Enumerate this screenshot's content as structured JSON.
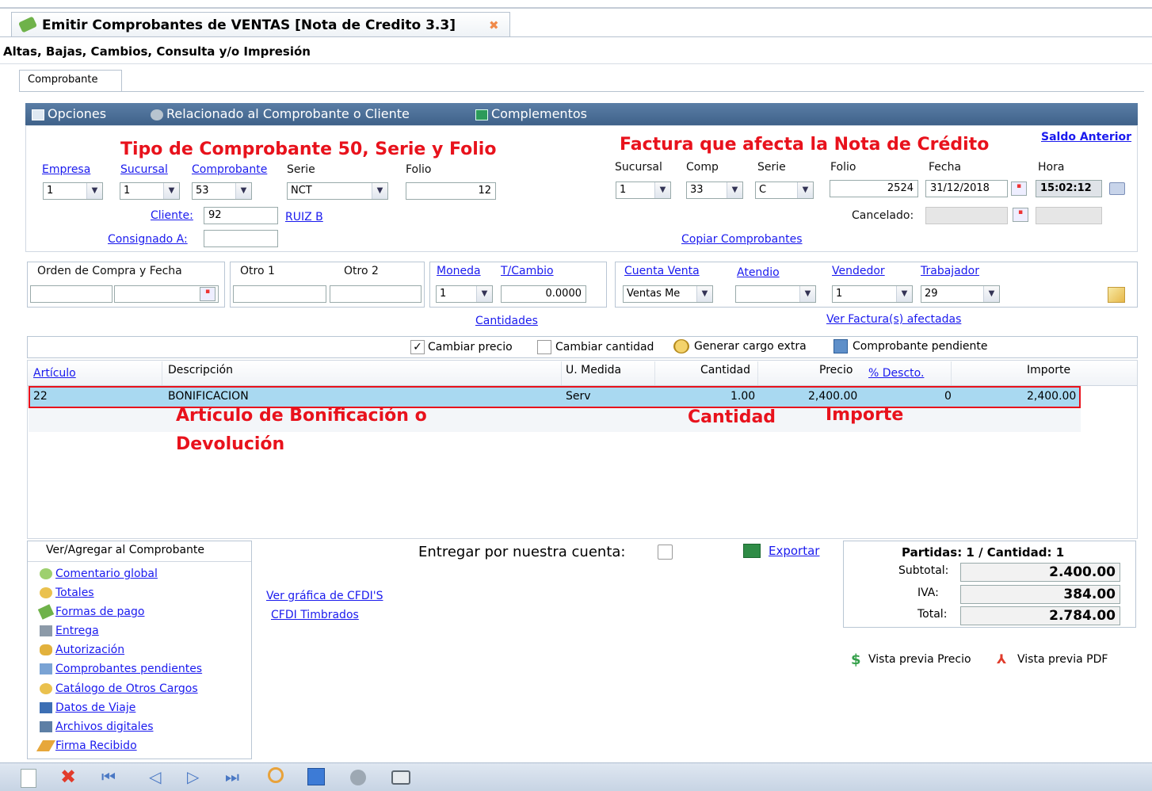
{
  "tab": {
    "title": "Emitir Comprobantes de VENTAS [Nota de Credito 3.3]",
    "close": "✖"
  },
  "subtitle": "Altas, Bajas, Cambios, Consulta y/o Impresión",
  "inner_tab": "Comprobante",
  "toolbar": {
    "opciones": "Opciones",
    "relacionado": "Relacionado al Comprobante o Cliente",
    "complementos": "Complementos"
  },
  "annotations": {
    "tipo": "Tipo de Comprobante 50, Serie y Folio",
    "factura": "Factura que afecta la Nota de Crédito",
    "articulo1": "Artículo de Bonificación o",
    "articulo2": "Devolución",
    "cantidad": "Cantidad",
    "importe": "Importe"
  },
  "header": {
    "saldo_anterior": "Saldo Anterior",
    "empresa_label": "Empresa",
    "empresa": "1",
    "sucursal_label": "Sucursal",
    "sucursal": "1",
    "comprobante_label": "Comprobante",
    "comprobante": "53",
    "serie_label": "Serie",
    "serie": "NCT",
    "folio_label": "Folio",
    "folio": "12",
    "cliente_label": "Cliente:",
    "cliente": "92",
    "cliente_nombre": "RUIZ B",
    "consignado_label": "Consignado A:",
    "consignado": "",
    "f_sucursal_label": "Sucursal",
    "f_sucursal": "1",
    "f_comp_label": "Comp",
    "f_comp": "33",
    "f_serie_label": "Serie",
    "f_serie": "C",
    "f_folio_label": "Folio",
    "f_folio": "2524",
    "fecha_label": "Fecha",
    "fecha": "31/12/2018",
    "hora_label": "Hora",
    "hora": "15:02:12",
    "cancelado_label": "Cancelado:",
    "copiar": "Copiar Comprobantes"
  },
  "mid": {
    "orden_label": "Orden de Compra y Fecha",
    "otro1_label": "Otro 1",
    "otro2_label": "Otro 2",
    "moneda_label": "Moneda",
    "tcambio_label": "T/Cambio",
    "moneda": "1",
    "tcambio": "0.0000",
    "cuenta_label": "Cuenta Venta",
    "cuenta": "Ventas Me",
    "atendio_label": "Atendio",
    "atendio": "",
    "vendedor_label": "Vendedor",
    "vendedor": "1",
    "trabajador_label": "Trabajador",
    "trabajador": "29",
    "cantidades": "Cantidades",
    "ver_facturas": "Ver Factura(s) afectadas"
  },
  "options": {
    "cambiar_precio": "Cambiar precio",
    "cambiar_cantidad": "Cambiar cantidad",
    "generar_cargo": "Generar cargo extra",
    "comprobante_pendiente": "Comprobante pendiente"
  },
  "grid": {
    "headers": {
      "articulo": "Artículo",
      "descripcion": "Descripción",
      "umedida": "U. Medida",
      "cantidad": "Cantidad",
      "precio": "Precio",
      "descto": "% Descto.",
      "importe": "Importe"
    },
    "rows": [
      {
        "articulo": "22",
        "descripcion": "BONIFICACION",
        "umedida": "Serv",
        "cantidad": "1.00",
        "precio": "2,400.00",
        "descto": "0",
        "importe": "2,400.00"
      }
    ]
  },
  "left_panel": {
    "title": "Ver/Agregar al Comprobante",
    "items": [
      "Comentario global",
      "Totales",
      "Formas de pago",
      "Entrega",
      "Autorización",
      "Comprobantes pendientes",
      "Catálogo de Otros Cargos",
      "Datos de Viaje",
      "Archivos digitales",
      "Firma Recibido"
    ]
  },
  "center": {
    "ver_grafica": "Ver gráfica de CFDI'S",
    "cfdi_timbrados": "CFDI Timbrados",
    "entregar": "Entregar por nuestra cuenta:",
    "exportar": "Exportar"
  },
  "totals": {
    "partidas": "Partidas: 1 / Cantidad: 1",
    "subtotal_label": "Subtotal:",
    "subtotal": "2.400.00",
    "iva_label": "IVA:",
    "iva": "384.00",
    "total_label": "Total:",
    "total": "2.784.00"
  },
  "preview": {
    "precio": "Vista previa Precio",
    "pdf": "Vista previa PDF"
  }
}
